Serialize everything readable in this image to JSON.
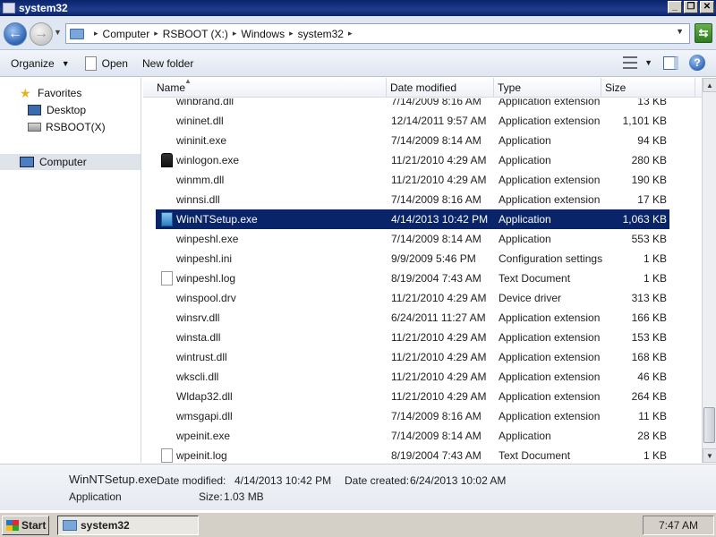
{
  "window": {
    "title": "system32",
    "minimize_glyph": "_",
    "maximize_glyph": "❐",
    "close_glyph": "✕"
  },
  "address": {
    "breadcrumbs": [
      "Computer",
      "RSBOOT (X:)",
      "Windows",
      "system32"
    ]
  },
  "toolbar": {
    "organize": "Organize",
    "open": "Open",
    "new_folder": "New folder",
    "help": "?"
  },
  "nav": {
    "favorites": "Favorites",
    "desktop": "Desktop",
    "rsboot": "RSBOOT(X)",
    "computer": "Computer"
  },
  "columns": {
    "name": "Name",
    "date": "Date modified",
    "type": "Type",
    "size": "Size"
  },
  "files": [
    {
      "name": "winbrand.dll",
      "date": "7/14/2009 8:16 AM",
      "type": "Application extension",
      "size": "13 KB",
      "icon": "none"
    },
    {
      "name": "wininet.dll",
      "date": "12/14/2011 9:57 AM",
      "type": "Application extension",
      "size": "1,101 KB",
      "icon": "none"
    },
    {
      "name": "wininit.exe",
      "date": "7/14/2009 8:14 AM",
      "type": "Application",
      "size": "94 KB",
      "icon": "none"
    },
    {
      "name": "winlogon.exe",
      "date": "11/21/2010 4:29 AM",
      "type": "Application",
      "size": "280 KB",
      "icon": "winlogon"
    },
    {
      "name": "winmm.dll",
      "date": "11/21/2010 4:29 AM",
      "type": "Application extension",
      "size": "190 KB",
      "icon": "none"
    },
    {
      "name": "winnsi.dll",
      "date": "7/14/2009 8:16 AM",
      "type": "Application extension",
      "size": "17 KB",
      "icon": "none"
    },
    {
      "name": "WinNTSetup.exe",
      "date": "4/14/2013 10:42 PM",
      "type": "Application",
      "size": "1,063 KB",
      "icon": "exeblue",
      "selected": true
    },
    {
      "name": "winpeshl.exe",
      "date": "7/14/2009 8:14 AM",
      "type": "Application",
      "size": "553 KB",
      "icon": "none"
    },
    {
      "name": "winpeshl.ini",
      "date": "9/9/2009 5:46 PM",
      "type": "Configuration settings",
      "size": "1 KB",
      "icon": "none"
    },
    {
      "name": "winpeshl.log",
      "date": "8/19/2004 7:43 AM",
      "type": "Text Document",
      "size": "1 KB",
      "icon": "doc"
    },
    {
      "name": "winspool.drv",
      "date": "11/21/2010 4:29 AM",
      "type": "Device driver",
      "size": "313 KB",
      "icon": "none"
    },
    {
      "name": "winsrv.dll",
      "date": "6/24/2011 11:27 AM",
      "type": "Application extension",
      "size": "166 KB",
      "icon": "none"
    },
    {
      "name": "winsta.dll",
      "date": "11/21/2010 4:29 AM",
      "type": "Application extension",
      "size": "153 KB",
      "icon": "none"
    },
    {
      "name": "wintrust.dll",
      "date": "11/21/2010 4:29 AM",
      "type": "Application extension",
      "size": "168 KB",
      "icon": "none"
    },
    {
      "name": "wkscli.dll",
      "date": "11/21/2010 4:29 AM",
      "type": "Application extension",
      "size": "46 KB",
      "icon": "none"
    },
    {
      "name": "Wldap32.dll",
      "date": "11/21/2010 4:29 AM",
      "type": "Application extension",
      "size": "264 KB",
      "icon": "none"
    },
    {
      "name": "wmsgapi.dll",
      "date": "7/14/2009 8:16 AM",
      "type": "Application extension",
      "size": "11 KB",
      "icon": "none"
    },
    {
      "name": "wpeinit.exe",
      "date": "7/14/2009 8:14 AM",
      "type": "Application",
      "size": "28 KB",
      "icon": "none"
    },
    {
      "name": "wpeinit.log",
      "date": "8/19/2004 7:43 AM",
      "type": "Text Document",
      "size": "1 KB",
      "icon": "doc"
    }
  ],
  "details": {
    "name": "WinNTSetup.exe",
    "modified_label": "Date modified:",
    "modified_value": "4/14/2013 10:42 PM",
    "created_label": "Date created:",
    "created_value": "6/24/2013 10:02 AM",
    "type": "Application",
    "size_label": "Size:",
    "size_value": "1.03 MB"
  },
  "taskbar": {
    "start": "Start",
    "task": "system32",
    "clock": "7:47 AM"
  },
  "colors": {
    "selection": "#0a246a",
    "titlebar": "#0a246a"
  }
}
